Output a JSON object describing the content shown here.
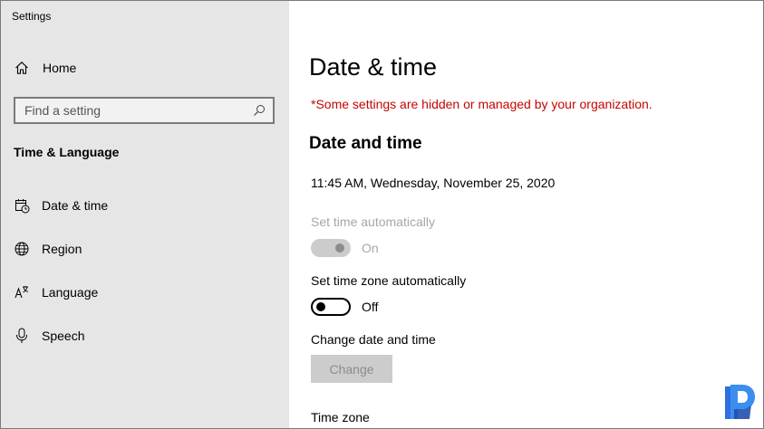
{
  "window": {
    "title": "Settings"
  },
  "sidebar": {
    "home_label": "Home",
    "search": {
      "placeholder": "Find a setting",
      "value": ""
    },
    "section_title": "Time & Language",
    "items": [
      {
        "label": "Date & time",
        "icon": "calendar-clock-icon"
      },
      {
        "label": "Region",
        "icon": "globe-icon"
      },
      {
        "label": "Language",
        "icon": "language-icon"
      },
      {
        "label": "Speech",
        "icon": "microphone-icon"
      }
    ]
  },
  "main": {
    "title": "Date & time",
    "org_notice": "*Some settings are hidden or managed by your organization.",
    "section_title": "Date and time",
    "current_time": "11:45 AM, Wednesday, November 25, 2020",
    "set_time_auto": {
      "label": "Set time automatically",
      "state": "On",
      "enabled": false
    },
    "set_timezone_auto": {
      "label": "Set time zone automatically",
      "state": "Off",
      "enabled": true
    },
    "change_datetime": {
      "label": "Change date and time",
      "button": "Change"
    },
    "timezone_label": "Time zone"
  },
  "colors": {
    "sidebar_bg": "#e6e6e6",
    "notice_red": "#c50500",
    "disabled_text": "#a6a6a6",
    "watermark_blue": "#2f6fe0"
  }
}
